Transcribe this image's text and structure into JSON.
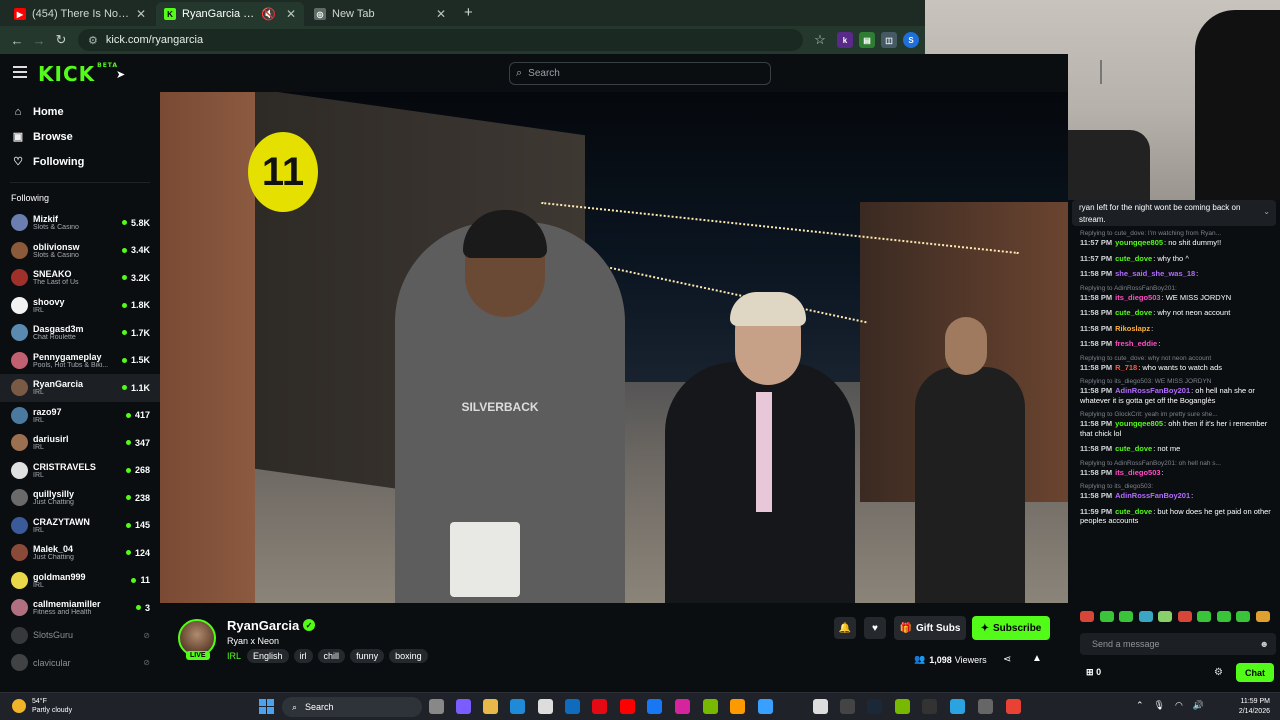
{
  "browser": {
    "tabs": [
      {
        "title": "(454) There Is No Tomorrow - Y",
        "favicon_color": "#ff0000",
        "favicon_glyph": "▶",
        "active": false
      },
      {
        "title": "RyanGarcia Stream - Watch",
        "favicon_color": "#53fc18",
        "favicon_glyph": "K",
        "active": true
      },
      {
        "title": "New Tab",
        "favicon_color": "#5f6b66",
        "favicon_glyph": "◎",
        "active": false
      }
    ],
    "url": "kick.com/ryangarcia"
  },
  "header": {
    "logo": "KICK",
    "logo_badge": "BETA",
    "search_placeholder": "Search"
  },
  "sidebar": {
    "nav": [
      {
        "label": "Home",
        "icon": "home-icon"
      },
      {
        "label": "Browse",
        "icon": "browse-icon"
      },
      {
        "label": "Following",
        "icon": "heart-icon"
      }
    ],
    "following_heading": "Following",
    "channels": [
      {
        "name": "Mizkif",
        "category": "Slots & Casino",
        "viewers": "5.8K",
        "color": "#6a7fb0"
      },
      {
        "name": "oblivionsw",
        "category": "Slots & Casino",
        "viewers": "3.4K",
        "color": "#8a5a3a"
      },
      {
        "name": "SNEAKO",
        "category": "The Last of Us",
        "viewers": "3.2K",
        "color": "#a0302a"
      },
      {
        "name": "shoovy",
        "category": "IRL",
        "viewers": "1.8K",
        "color": "#f2f2f2"
      },
      {
        "name": "Dasgasd3m",
        "category": "Chat Roulette",
        "viewers": "1.7K",
        "color": "#5a8ab0"
      },
      {
        "name": "Pennygameplay",
        "category": "Pools, Hot Tubs & Biki...",
        "viewers": "1.5K",
        "color": "#c06070"
      },
      {
        "name": "RyanGarcia",
        "category": "IRL",
        "viewers": "1.1K",
        "color": "#7a5a45"
      },
      {
        "name": "razo97",
        "category": "IRL",
        "viewers": "417",
        "color": "#4a7aa0"
      },
      {
        "name": "dariusirl",
        "category": "IRL",
        "viewers": "347",
        "color": "#9a7050"
      },
      {
        "name": "CRISTRAVELS",
        "category": "IRL",
        "viewers": "268",
        "color": "#e0e0e0"
      },
      {
        "name": "quillysilly",
        "category": "Just Chatting",
        "viewers": "238",
        "color": "#6a6a6a"
      },
      {
        "name": "CRAZYTAWN",
        "category": "IRL",
        "viewers": "145",
        "color": "#3a5a9a"
      },
      {
        "name": "Malek_04",
        "category": "Just Chatting",
        "viewers": "124",
        "color": "#8a4a3a"
      },
      {
        "name": "goldman999",
        "category": "IRL",
        "viewers": "11",
        "color": "#e8d84a"
      },
      {
        "name": "callmemiamiller",
        "category": "Fitness and Health",
        "viewers": "3",
        "color": "#b07080"
      }
    ],
    "offline_channels": [
      {
        "name": "SlotsGuru",
        "color": "#555"
      },
      {
        "name": "clavicular",
        "color": "#666"
      }
    ]
  },
  "video": {
    "sign_number": "11",
    "shirt_text": "SILVERBACK"
  },
  "stream": {
    "streamer": "RyanGarcia",
    "live_badge": "LIVE",
    "title": "Ryan x Neon",
    "category": "IRL",
    "tags": [
      "English",
      "irl",
      "chill",
      "funny",
      "boxing"
    ],
    "gift_label": "Gift Subs",
    "subscribe_label": "Subscribe",
    "viewers": "1,098",
    "viewers_label": "Viewers"
  },
  "chat": {
    "pinned": "ryan left for the night wont be coming back on stream.",
    "messages": [
      {
        "reply": "Replying to cute_dove: I'm watching from Ryan...",
        "time": "11:57 PM",
        "user": "youngqee805",
        "color": "#53fc18",
        "text": ": no shit dummy!!"
      },
      {
        "reply": "",
        "time": "11:57 PM",
        "user": "cute_dove",
        "color": "#53fc18",
        "text": ": why tho ^"
      },
      {
        "reply": "",
        "time": "11:58 PM",
        "user": "she_said_she_was_18",
        "color": "#b36cff",
        "text": ":"
      },
      {
        "reply": "Replying to AdinRossFanBoy201:",
        "time": "11:58 PM",
        "user": "its_diego503",
        "color": "#ff4dc4",
        "text": ": WE MISS JORDYN"
      },
      {
        "reply": "",
        "time": "11:58 PM",
        "user": "cute_dove",
        "color": "#53fc18",
        "text": ": why not neon account"
      },
      {
        "reply": "",
        "time": "11:58 PM",
        "user": "Rikoslapz",
        "color": "#ffb13b",
        "text": ":"
      },
      {
        "reply": "",
        "time": "11:58 PM",
        "user": "fresh_eddie",
        "color": "#ff4dc4",
        "text": ":"
      },
      {
        "reply": "Replying to cute_dove: why not neon account",
        "time": "11:58 PM",
        "user": "R_718",
        "color": "#ff5a3c",
        "text": ": who wants to watch ads"
      },
      {
        "reply": "Replying to its_diego503: WE MISS JORDYN",
        "time": "11:58 PM",
        "user": "AdinRossFanBoy201",
        "color": "#b36cff",
        "text": ": oh hell nah she or whatever it is gotta get off the Boganglès"
      },
      {
        "reply": "Replying to GlockCrit: yeah im pretty sure she...",
        "time": "11:58 PM",
        "user": "youngqee805",
        "color": "#53fc18",
        "text": ": ohh then if it's her i remember that chick lol"
      },
      {
        "reply": "",
        "time": "11:58 PM",
        "user": "cute_dove",
        "color": "#53fc18",
        "text": ": not me"
      },
      {
        "reply": "Replying to AdinRossFanBoy201: oh hell nah s...",
        "time": "11:58 PM",
        "user": "its_diego503",
        "color": "#ff4dc4",
        "text": ":"
      },
      {
        "reply": "Replying to its_diego503:",
        "time": "11:58 PM",
        "user": "AdinRossFanBoy201",
        "color": "#b36cff",
        "text": ":"
      },
      {
        "reply": "",
        "time": "11:59 PM",
        "user": "cute_dove",
        "color": "#53fc18",
        "text": ": but how does he get paid on other peoples accounts"
      }
    ],
    "input_placeholder": "Send a message",
    "points": "0",
    "chat_button": "Chat"
  },
  "taskbar": {
    "weather_temp": "54°F",
    "weather_desc": "Partly cloudy",
    "search_label": "Search",
    "time": "11:59 PM",
    "date": "2/14/2026"
  }
}
